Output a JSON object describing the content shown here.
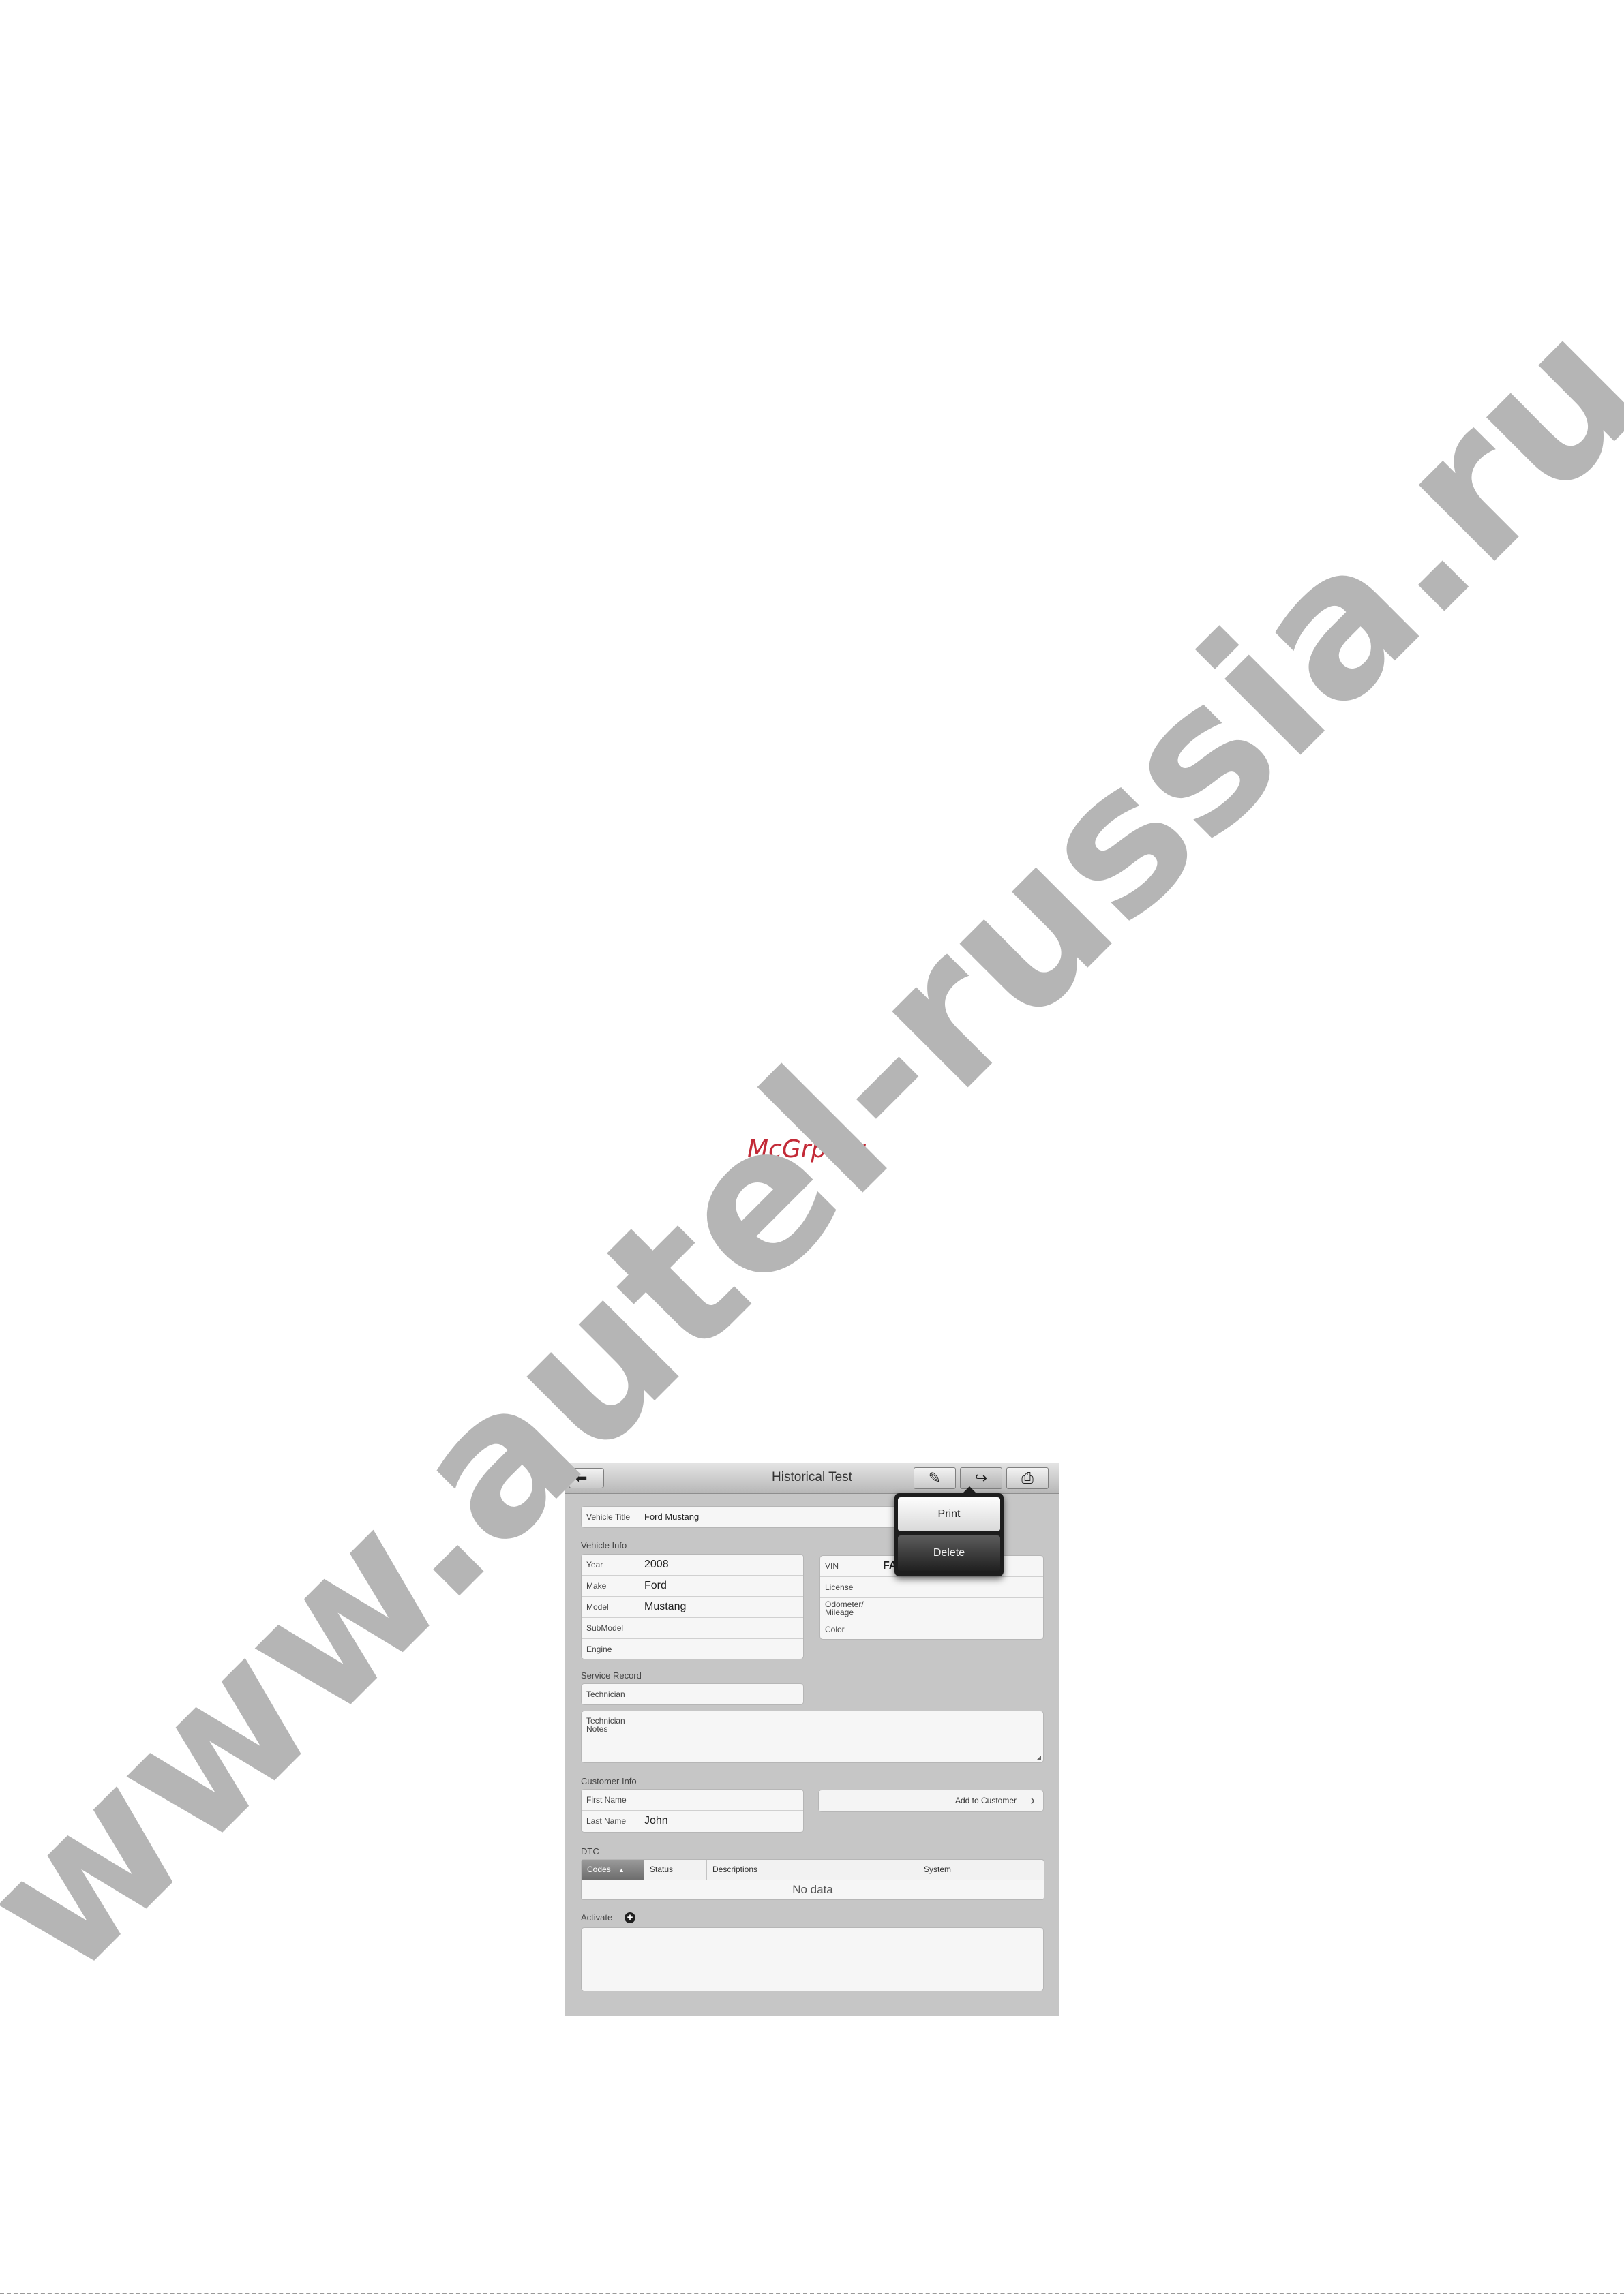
{
  "watermark": {
    "site_text": "www.autel-russia.ru",
    "mcgrp_text": "McGrp.Ru"
  },
  "colors": {
    "watermark": "#b5b5b5",
    "mcgrp": "#c32a37",
    "frame_bg": "#c6c6c6"
  },
  "header": {
    "back_icon": "back-arrow-icon",
    "title": "Historical Test",
    "edit_icon": "edit-icon",
    "share_icon": "share-icon",
    "print_icon": "printer-icon"
  },
  "popover": {
    "print_label": "Print",
    "delete_label": "Delete"
  },
  "vehicle_title": {
    "label": "Vehicle Title",
    "value": "Ford Mustang"
  },
  "vehicle_info": {
    "title": "Vehicle Info",
    "left_fields": [
      {
        "label": "Year",
        "value": "2008"
      },
      {
        "label": "Make",
        "value": "Ford"
      },
      {
        "label": "Model",
        "value": "Mustang"
      },
      {
        "label": "SubModel",
        "value": ""
      },
      {
        "label": "Engine",
        "value": ""
      }
    ],
    "right_fields": [
      {
        "label": "VIN",
        "value": "FA"
      },
      {
        "label": "License",
        "value": ""
      },
      {
        "label": "Odometer/ Mileage",
        "value": ""
      },
      {
        "label": "Color",
        "value": ""
      }
    ]
  },
  "service_record": {
    "title": "Service Record",
    "technician_label": "Technician",
    "technician_value": "",
    "notes_label": "Technician Notes"
  },
  "customer_info": {
    "title": "Customer Info",
    "first_name_label": "First Name",
    "first_name_value": "",
    "last_name_label": "Last Name",
    "last_name_value": "John",
    "add_button_label": "Add to Customer",
    "add_button_icon": "chevron-right-icon"
  },
  "dtc": {
    "title": "DTC",
    "columns": [
      "Codes",
      "Status",
      "Descriptions",
      "System"
    ],
    "sort_icon": "sort-arrow-icon",
    "empty_text": "No data"
  },
  "activate": {
    "label": "Activate",
    "icon": "add-circle-icon"
  }
}
